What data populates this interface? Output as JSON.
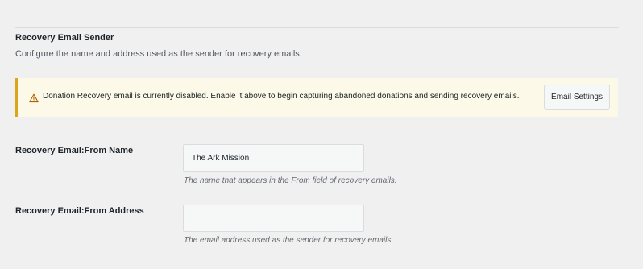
{
  "section": {
    "title": "Recovery Email Sender",
    "description": "Configure the name and address used as the sender for recovery emails."
  },
  "notice": {
    "icon": "warning-icon",
    "icon_color": "#dba617",
    "background": "#fcf9e8",
    "text": "Donation Recovery email is currently disabled. Enable it above to begin capturing abandoned donations and sending recovery emails.",
    "button_label": "Email Settings"
  },
  "fields": {
    "from_name": {
      "label": "Recovery Email:From Name",
      "value": "The Ark Mission",
      "placeholder": "",
      "help": "The name that appears in the From field of recovery emails."
    },
    "from_address": {
      "label": "Recovery Email:From Address",
      "value": "",
      "placeholder": "",
      "help": "The email address used as the sender for recovery emails."
    }
  }
}
